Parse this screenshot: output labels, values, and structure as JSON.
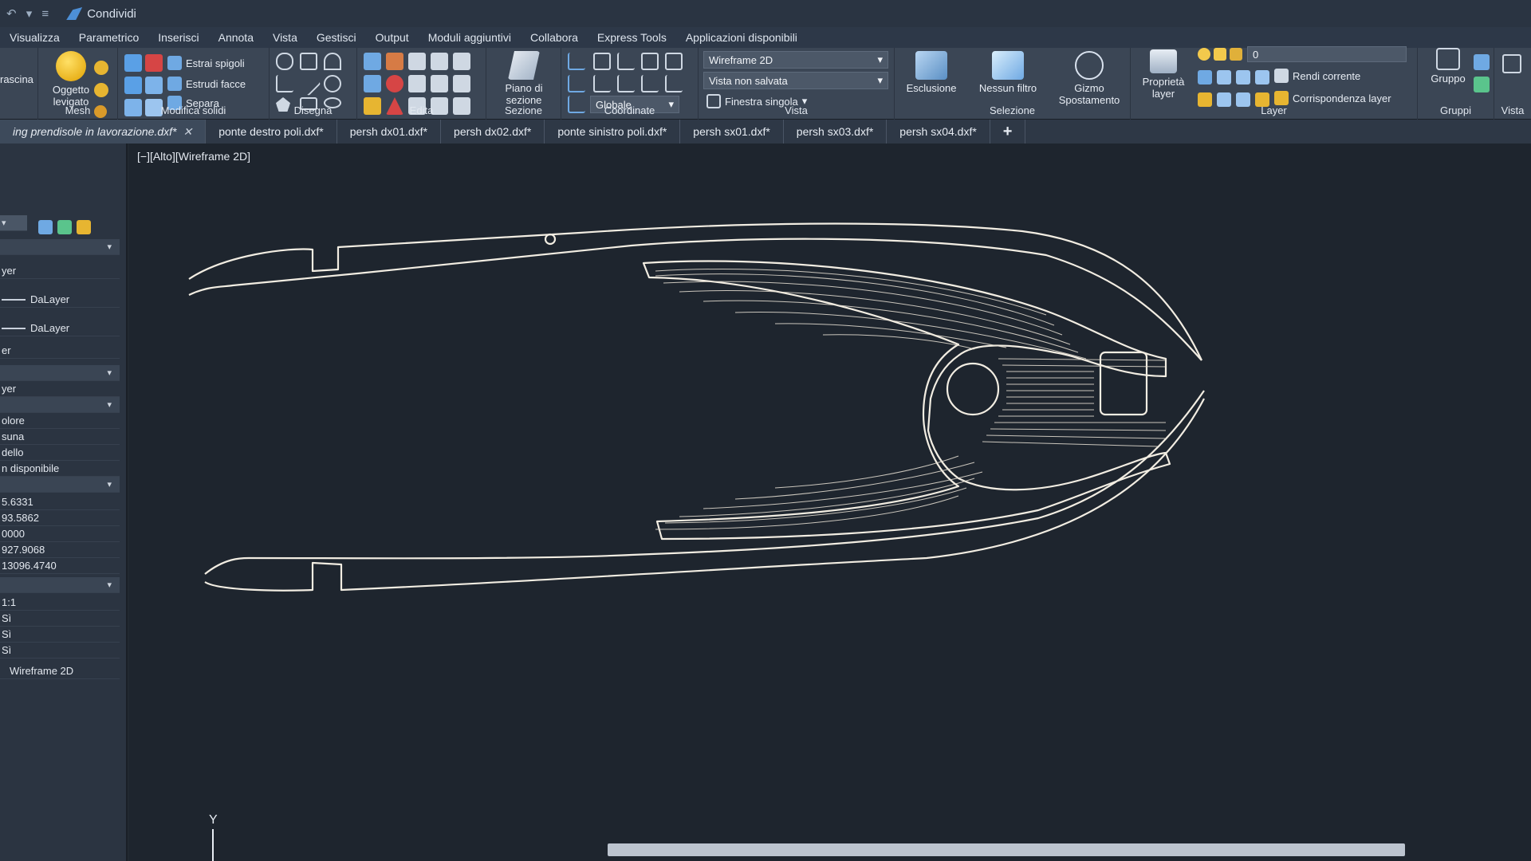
{
  "app": {
    "share_label": "Condividi",
    "quick_access": "↶ ▾ ≡"
  },
  "menu": {
    "items": [
      "Visualizza",
      "Parametrico",
      "Inserisci",
      "Annota",
      "Vista",
      "Gestisci",
      "Output",
      "Moduli aggiuntivi",
      "Collabora",
      "Express Tools",
      "Applicazioni disponibili"
    ]
  },
  "ribbon": {
    "trascina": "rascina",
    "mesh": {
      "title": "Mesh",
      "smooth_object_line1": "Oggetto",
      "smooth_object_line2": "levigato"
    },
    "solid_edit": {
      "title": "Modifica solidi",
      "extract_edges": "Estrai spigoli",
      "extrude_faces": "Estrudi facce",
      "separate": "Separa"
    },
    "draw": {
      "title": "Disegna"
    },
    "edit": {
      "title": "Edita"
    },
    "section": {
      "title": "Sezione",
      "plane_line1": "Piano di",
      "plane_line2": "sezione"
    },
    "coordinates": {
      "title": "Coordinate",
      "ucs_combo": "Globale"
    },
    "view": {
      "title": "Vista",
      "visual_style": "Wireframe 2D",
      "saved_view": "Vista non salvata",
      "viewport": "Finestra singola"
    },
    "selection": {
      "title": "Selezione",
      "isolate": "Esclusione",
      "no_filter": "Nessun filtro",
      "gizmo_line1": "Gizmo",
      "gizmo_line2": "Spostamento"
    },
    "layers": {
      "title": "Layer",
      "properties_line1": "Proprietà",
      "properties_line2": "layer",
      "layer_combo": "0",
      "make_current": "Rendi corrente",
      "match_layer": "Corrispondenza layer"
    },
    "groups": {
      "title": "Gruppi",
      "group": "Gruppo"
    },
    "view2": {
      "title": "Vista"
    }
  },
  "doc_tabs": [
    {
      "label": "ing prendisole in lavorazione.dxf*",
      "active": true
    },
    {
      "label": "ponte destro poli.dxf*"
    },
    {
      "label": "persh dx01.dxf*"
    },
    {
      "label": "persh dx02.dxf*"
    },
    {
      "label": "ponte sinistro poli.dxf*"
    },
    {
      "label": "persh sx01.dxf*"
    },
    {
      "label": "persh sx03.dxf*"
    },
    {
      "label": "persh sx04.dxf*"
    },
    {
      "label": "+"
    }
  ],
  "properties": {
    "rows": [
      "yer",
      "DaLayer",
      "DaLayer",
      "er",
      "",
      "yer",
      "",
      "olore",
      "suna",
      "dello",
      "n disponibile",
      "",
      "5.6331",
      "93.5862",
      "0000",
      "927.9068",
      "13096.4740",
      "",
      "1:1",
      "Sì",
      "Sì",
      "Sì",
      "Wireframe 2D"
    ]
  },
  "viewport": {
    "label": "[−][Alto][Wireframe 2D]",
    "ucs_axis": "Y"
  },
  "colors": {
    "canvas_bg": "#1e252e",
    "geometry": "#f2ede2",
    "ribbon_bg": "#3b4655"
  }
}
